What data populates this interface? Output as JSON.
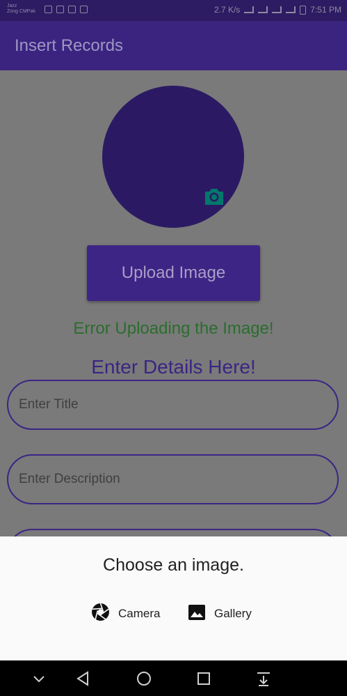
{
  "status_bar": {
    "carrier_line1": "Jazz",
    "carrier_line2": "Zong CMPak",
    "speed": "2.7 K/s",
    "time": "7:51 PM"
  },
  "app_bar": {
    "title": "Insert Records"
  },
  "main": {
    "upload_button_label": "Upload Image",
    "error_message": "Error Uploading the Image!",
    "details_heading": "Enter Details Here!",
    "title_placeholder": "Enter Title",
    "description_placeholder": "Enter Description"
  },
  "bottom_sheet": {
    "heading": "Choose an image.",
    "options": [
      {
        "label": "Camera",
        "icon": "camera-aperture-icon"
      },
      {
        "label": "Gallery",
        "icon": "image-icon"
      }
    ]
  },
  "colors": {
    "primary": "#3a2480",
    "avatar": "#2b1a63",
    "error_text": "#2b6d2e",
    "accent_badge": "#00796b",
    "scrim": "#7a7a7a",
    "sheet": "#fafafa"
  },
  "nav_bar": {
    "icons": [
      "chevron-down-icon",
      "back-icon",
      "home-icon",
      "recents-icon",
      "notification-pull-icon"
    ]
  }
}
